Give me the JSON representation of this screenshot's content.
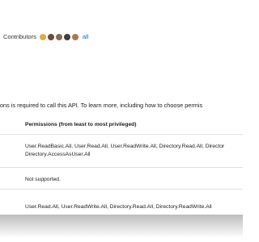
{
  "contributors": {
    "label": "Contributors",
    "avatars": [
      {
        "name": "contributor-1",
        "color": "#e1a94a"
      },
      {
        "name": "contributor-2",
        "color": "#6b4a3a"
      },
      {
        "name": "contributor-3",
        "color": "#8a6a55"
      },
      {
        "name": "contributor-4",
        "color": "#3f3f3f"
      },
      {
        "name": "contributor-5",
        "color": "#a8794f"
      }
    ],
    "all_link": "all"
  },
  "intro_text": "ons is required to call this API. To learn more, including how to choose permis",
  "permissions_table": {
    "header": "Permissions (from least to most privileged)",
    "rows": [
      {
        "line1": "User.ReadBasic.All, User.Read.All, User.ReadWrite.All, Directory.Read.All, Director",
        "line2": "Directory.AccessAsUser.All"
      },
      {
        "line1": "Not supported."
      },
      {
        "line1": "User.Read.All, User.ReadWrite.All, Directory.Read.All, Directory.ReadWrite.All"
      }
    ]
  },
  "colors": {
    "link": "#0f6cbd",
    "text": "#1b1b1b",
    "border": "#e1dfdd"
  }
}
